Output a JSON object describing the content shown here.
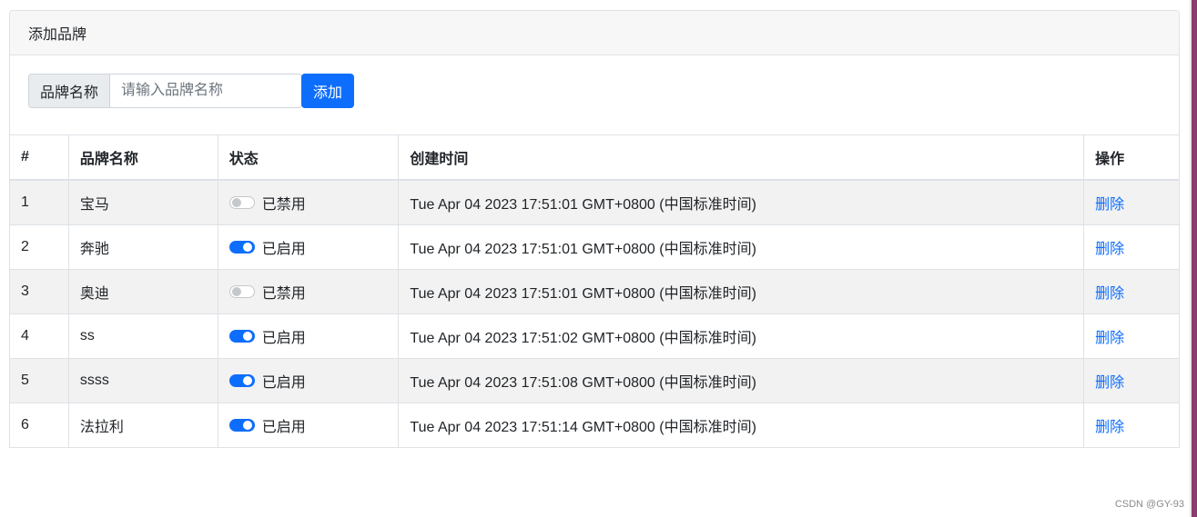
{
  "card": {
    "header_title": "添加品牌",
    "input_prefix": "品牌名称",
    "input_placeholder": "请输入品牌名称",
    "input_value": "",
    "add_button": "添加"
  },
  "table": {
    "headers": {
      "id": "#",
      "name": "品牌名称",
      "status": "状态",
      "time": "创建时间",
      "op": "操作"
    },
    "rows": [
      {
        "id": "1",
        "name": "宝马",
        "enabled": false,
        "status_label": "已禁用",
        "time": "Tue Apr 04 2023 17:51:01 GMT+0800 (中国标准时间)",
        "op": "删除"
      },
      {
        "id": "2",
        "name": "奔驰",
        "enabled": true,
        "status_label": "已启用",
        "time": "Tue Apr 04 2023 17:51:01 GMT+0800 (中国标准时间)",
        "op": "删除"
      },
      {
        "id": "3",
        "name": "奥迪",
        "enabled": false,
        "status_label": "已禁用",
        "time": "Tue Apr 04 2023 17:51:01 GMT+0800 (中国标准时间)",
        "op": "删除"
      },
      {
        "id": "4",
        "name": "ss",
        "enabled": true,
        "status_label": "已启用",
        "time": "Tue Apr 04 2023 17:51:02 GMT+0800 (中国标准时间)",
        "op": "删除"
      },
      {
        "id": "5",
        "name": "ssss",
        "enabled": true,
        "status_label": "已启用",
        "time": "Tue Apr 04 2023 17:51:08 GMT+0800 (中国标准时间)",
        "op": "删除"
      },
      {
        "id": "6",
        "name": "法拉利",
        "enabled": true,
        "status_label": "已启用",
        "time": "Tue Apr 04 2023 17:51:14 GMT+0800 (中国标准时间)",
        "op": "删除"
      }
    ]
  },
  "credit": "CSDN @GY-93",
  "colors": {
    "primary": "#0d6efd",
    "stripe": "#f2f2f2",
    "border": "#dee2e6"
  }
}
